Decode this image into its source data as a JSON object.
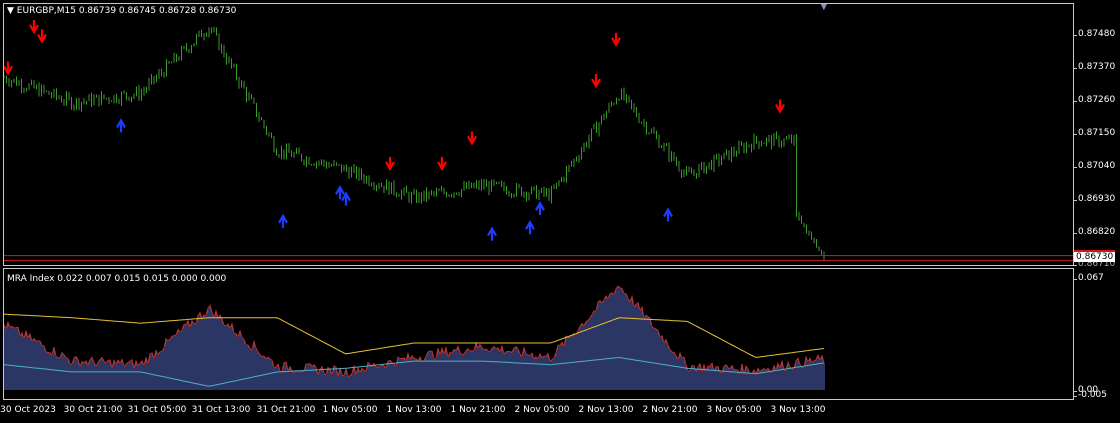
{
  "colors": {
    "background": "#000000",
    "price_bars": "#3a9a2a",
    "sell_arrow": "#ff0000",
    "buy_arrow": "#1e3cff",
    "price_line": "#c81e1e",
    "bid_tag": "#ffffff",
    "histogram": "#4a5aa8",
    "histogram_outline": "#c0302a",
    "signal_line": "#e6c22e",
    "lower_line": "#4fb0c0",
    "grid_frame": "#c8c8c8"
  },
  "main_chart": {
    "symbol_menu_icon": "triangle-down-icon",
    "title": "EURGBP,M15  0.86739 0.86745 0.86728 0.86730",
    "price_axis_ticks": [
      "0.87480",
      "0.87370",
      "0.87260",
      "0.87150",
      "0.87040",
      "0.86930",
      "0.86820",
      "0.86710"
    ],
    "current_price_tag": "0.86730",
    "sell_arrow_icon": "arrow-down-icon",
    "buy_arrow_icon": "arrow-up-icon",
    "scroll_marker_icon": "triangle-down-icon"
  },
  "indicator": {
    "title": "MRA Index 0.022 0.007 0.015 0.015 0.000 0.000",
    "axis_ticks": [
      "0.067",
      "0.00",
      "-0.005"
    ]
  },
  "time_axis": {
    "labels": [
      "30 Oct 2023",
      "30 Oct 21:00",
      "31 Oct 05:00",
      "31 Oct 13:00",
      "31 Oct 21:00",
      "1 Nov 05:00",
      "1 Nov 13:00",
      "1 Nov 21:00",
      "2 Nov 05:00",
      "2 Nov 13:00",
      "2 Nov 21:00",
      "3 Nov 05:00",
      "3 Nov 13:00"
    ]
  },
  "chart_data": [
    {
      "type": "line",
      "title": "EURGBP,M15",
      "ohlc_last": {
        "open": 0.86739,
        "high": 0.86745,
        "low": 0.86728,
        "close": 0.8673
      },
      "x": [
        "30 Oct 2023",
        "30 Oct 21:00",
        "31 Oct 05:00",
        "31 Oct 13:00",
        "31 Oct 21:00",
        "1 Nov 05:00",
        "1 Nov 13:00",
        "1 Nov 21:00",
        "2 Nov 05:00",
        "2 Nov 13:00",
        "2 Nov 21:00",
        "3 Nov 05:00",
        "3 Nov 13:00"
      ],
      "ylim": [
        0.8671,
        0.8753
      ],
      "grid": false,
      "series": [
        {
          "name": "",
          "values": [
            0.873,
            0.8722,
            0.8725,
            0.8746,
            0.8707,
            0.8701,
            0.8692,
            0.8696,
            0.8693,
            0.8725,
            0.8699,
            0.871,
            0.871
          ]
        }
      ],
      "last_price": 0.8673
    },
    {
      "type": "area",
      "title": "MRA Index",
      "values_shown": [
        0.022,
        0.007,
        0.015,
        0.015,
        0.0,
        0.0
      ],
      "ylim": [
        -0.005,
        0.067
      ],
      "grid": false,
      "series": [
        {
          "name": "",
          "values": [
            0.036,
            0.016,
            0.014,
            0.045,
            0.013,
            0.01,
            0.018,
            0.024,
            0.018,
            0.058,
            0.013,
            0.011,
            0.017
          ]
        },
        {
          "name": "",
          "values": [
            0.042,
            0.04,
            0.037,
            0.04,
            0.04,
            0.02,
            0.026,
            0.026,
            0.026,
            0.04,
            0.038,
            0.018,
            0.023
          ]
        },
        {
          "name": "",
          "values": [
            0.014,
            0.01,
            0.01,
            0.002,
            0.01,
            0.012,
            0.016,
            0.016,
            0.014,
            0.018,
            0.012,
            0.009,
            0.015
          ]
        }
      ]
    }
  ]
}
